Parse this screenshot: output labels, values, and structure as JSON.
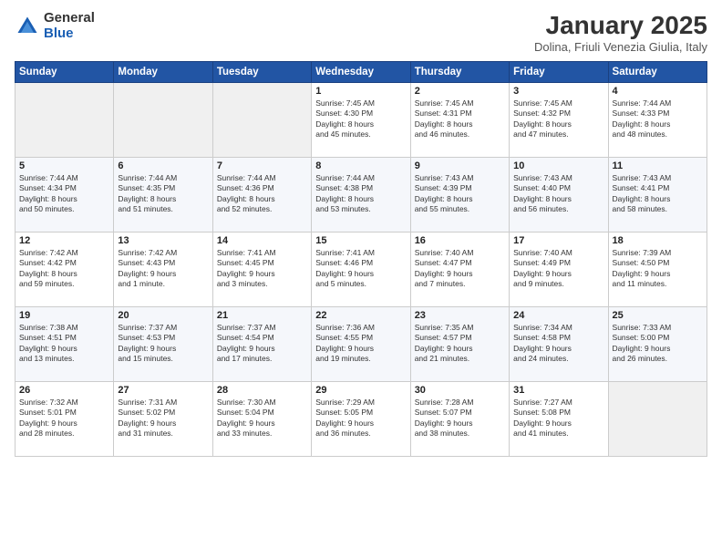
{
  "logo": {
    "general": "General",
    "blue": "Blue"
  },
  "header": {
    "month": "January 2025",
    "location": "Dolina, Friuli Venezia Giulia, Italy"
  },
  "weekdays": [
    "Sunday",
    "Monday",
    "Tuesday",
    "Wednesday",
    "Thursday",
    "Friday",
    "Saturday"
  ],
  "weeks": [
    [
      {
        "day": "",
        "info": ""
      },
      {
        "day": "",
        "info": ""
      },
      {
        "day": "",
        "info": ""
      },
      {
        "day": "1",
        "info": "Sunrise: 7:45 AM\nSunset: 4:30 PM\nDaylight: 8 hours\nand 45 minutes."
      },
      {
        "day": "2",
        "info": "Sunrise: 7:45 AM\nSunset: 4:31 PM\nDaylight: 8 hours\nand 46 minutes."
      },
      {
        "day": "3",
        "info": "Sunrise: 7:45 AM\nSunset: 4:32 PM\nDaylight: 8 hours\nand 47 minutes."
      },
      {
        "day": "4",
        "info": "Sunrise: 7:44 AM\nSunset: 4:33 PM\nDaylight: 8 hours\nand 48 minutes."
      }
    ],
    [
      {
        "day": "5",
        "info": "Sunrise: 7:44 AM\nSunset: 4:34 PM\nDaylight: 8 hours\nand 50 minutes."
      },
      {
        "day": "6",
        "info": "Sunrise: 7:44 AM\nSunset: 4:35 PM\nDaylight: 8 hours\nand 51 minutes."
      },
      {
        "day": "7",
        "info": "Sunrise: 7:44 AM\nSunset: 4:36 PM\nDaylight: 8 hours\nand 52 minutes."
      },
      {
        "day": "8",
        "info": "Sunrise: 7:44 AM\nSunset: 4:38 PM\nDaylight: 8 hours\nand 53 minutes."
      },
      {
        "day": "9",
        "info": "Sunrise: 7:43 AM\nSunset: 4:39 PM\nDaylight: 8 hours\nand 55 minutes."
      },
      {
        "day": "10",
        "info": "Sunrise: 7:43 AM\nSunset: 4:40 PM\nDaylight: 8 hours\nand 56 minutes."
      },
      {
        "day": "11",
        "info": "Sunrise: 7:43 AM\nSunset: 4:41 PM\nDaylight: 8 hours\nand 58 minutes."
      }
    ],
    [
      {
        "day": "12",
        "info": "Sunrise: 7:42 AM\nSunset: 4:42 PM\nDaylight: 8 hours\nand 59 minutes."
      },
      {
        "day": "13",
        "info": "Sunrise: 7:42 AM\nSunset: 4:43 PM\nDaylight: 9 hours\nand 1 minute."
      },
      {
        "day": "14",
        "info": "Sunrise: 7:41 AM\nSunset: 4:45 PM\nDaylight: 9 hours\nand 3 minutes."
      },
      {
        "day": "15",
        "info": "Sunrise: 7:41 AM\nSunset: 4:46 PM\nDaylight: 9 hours\nand 5 minutes."
      },
      {
        "day": "16",
        "info": "Sunrise: 7:40 AM\nSunset: 4:47 PM\nDaylight: 9 hours\nand 7 minutes."
      },
      {
        "day": "17",
        "info": "Sunrise: 7:40 AM\nSunset: 4:49 PM\nDaylight: 9 hours\nand 9 minutes."
      },
      {
        "day": "18",
        "info": "Sunrise: 7:39 AM\nSunset: 4:50 PM\nDaylight: 9 hours\nand 11 minutes."
      }
    ],
    [
      {
        "day": "19",
        "info": "Sunrise: 7:38 AM\nSunset: 4:51 PM\nDaylight: 9 hours\nand 13 minutes."
      },
      {
        "day": "20",
        "info": "Sunrise: 7:37 AM\nSunset: 4:53 PM\nDaylight: 9 hours\nand 15 minutes."
      },
      {
        "day": "21",
        "info": "Sunrise: 7:37 AM\nSunset: 4:54 PM\nDaylight: 9 hours\nand 17 minutes."
      },
      {
        "day": "22",
        "info": "Sunrise: 7:36 AM\nSunset: 4:55 PM\nDaylight: 9 hours\nand 19 minutes."
      },
      {
        "day": "23",
        "info": "Sunrise: 7:35 AM\nSunset: 4:57 PM\nDaylight: 9 hours\nand 21 minutes."
      },
      {
        "day": "24",
        "info": "Sunrise: 7:34 AM\nSunset: 4:58 PM\nDaylight: 9 hours\nand 24 minutes."
      },
      {
        "day": "25",
        "info": "Sunrise: 7:33 AM\nSunset: 5:00 PM\nDaylight: 9 hours\nand 26 minutes."
      }
    ],
    [
      {
        "day": "26",
        "info": "Sunrise: 7:32 AM\nSunset: 5:01 PM\nDaylight: 9 hours\nand 28 minutes."
      },
      {
        "day": "27",
        "info": "Sunrise: 7:31 AM\nSunset: 5:02 PM\nDaylight: 9 hours\nand 31 minutes."
      },
      {
        "day": "28",
        "info": "Sunrise: 7:30 AM\nSunset: 5:04 PM\nDaylight: 9 hours\nand 33 minutes."
      },
      {
        "day": "29",
        "info": "Sunrise: 7:29 AM\nSunset: 5:05 PM\nDaylight: 9 hours\nand 36 minutes."
      },
      {
        "day": "30",
        "info": "Sunrise: 7:28 AM\nSunset: 5:07 PM\nDaylight: 9 hours\nand 38 minutes."
      },
      {
        "day": "31",
        "info": "Sunrise: 7:27 AM\nSunset: 5:08 PM\nDaylight: 9 hours\nand 41 minutes."
      },
      {
        "day": "",
        "info": ""
      }
    ]
  ]
}
